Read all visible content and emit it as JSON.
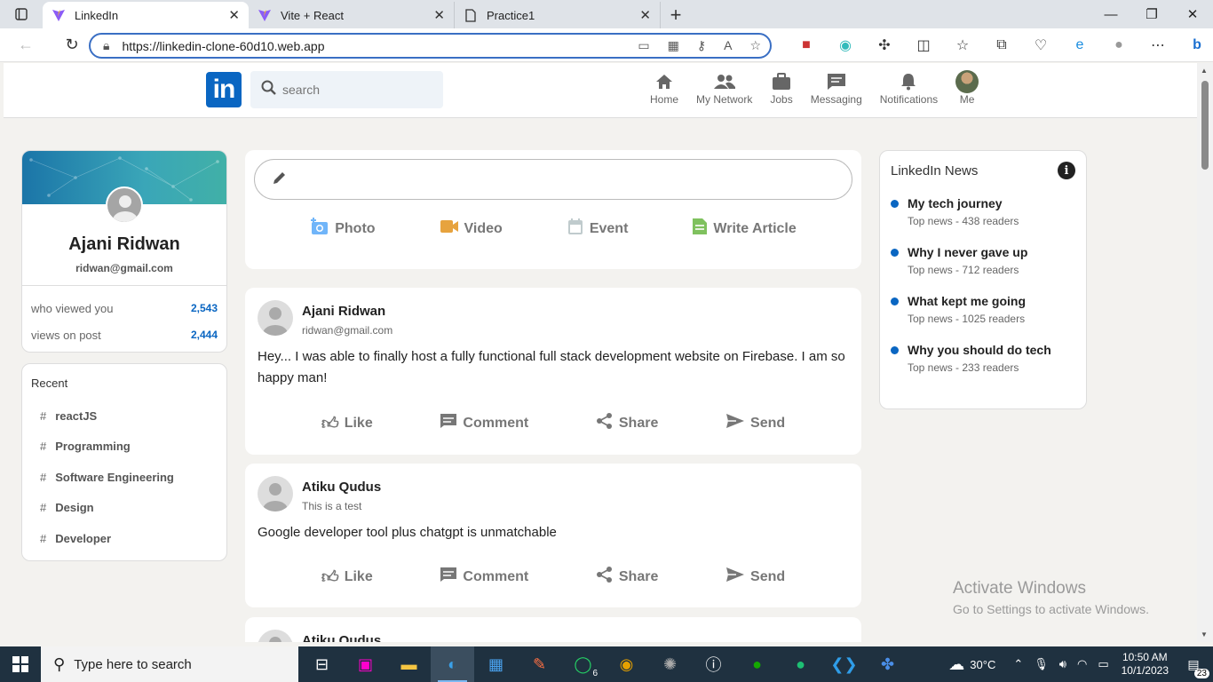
{
  "browser": {
    "tabs": [
      {
        "label": "LinkedIn",
        "active": true
      },
      {
        "label": "Vite + React",
        "active": false
      },
      {
        "label": "Practice1",
        "active": false
      }
    ],
    "url": "https://linkedin-clone-60d10.web.app"
  },
  "header": {
    "logo_text": "in",
    "search_placeholder": "search",
    "nav": [
      {
        "label": "Home",
        "icon": "home-icon"
      },
      {
        "label": "My Network",
        "icon": "network-icon"
      },
      {
        "label": "Jobs",
        "icon": "briefcase-icon"
      },
      {
        "label": "Messaging",
        "icon": "message-icon"
      },
      {
        "label": "Notifications",
        "icon": "bell-icon"
      },
      {
        "label": "Me",
        "icon": "avatar"
      }
    ]
  },
  "profile": {
    "name": "Ajani Ridwan",
    "email": "ridwan@gmail.com",
    "stats": [
      {
        "label": "who viewed you",
        "value": "2,543"
      },
      {
        "label": "views on post",
        "value": "2,444"
      }
    ]
  },
  "recent": {
    "title": "Recent",
    "items": [
      "reactJS",
      "Programming",
      "Software Engineering",
      "Design",
      "Developer"
    ]
  },
  "share": {
    "actions": [
      {
        "label": "Photo",
        "icon": "photo-icon",
        "color": "#70b5f9"
      },
      {
        "label": "Video",
        "icon": "video-icon",
        "color": "#e7a33e"
      },
      {
        "label": "Event",
        "icon": "calendar-icon",
        "color": "#c0cbcd"
      },
      {
        "label": "Write Article",
        "icon": "article-icon",
        "color": "#7fc15e"
      }
    ]
  },
  "posts": [
    {
      "name": "Ajani Ridwan",
      "desc": "ridwan@gmail.com",
      "message": "Hey... I was able to finally host a fully functional full stack development website on Firebase. I am so happy man!"
    },
    {
      "name": "Atiku Qudus",
      "desc": "This is a test",
      "message": "Google developer tool plus chatgpt is unmatchable"
    },
    {
      "name": "Atiku Qudus",
      "desc": "",
      "message": ""
    }
  ],
  "post_actions": [
    "Like",
    "Comment",
    "Share",
    "Send"
  ],
  "news": {
    "title": "LinkedIn News",
    "items": [
      {
        "heading": "My tech journey",
        "subtitle": "Top news - 438 readers"
      },
      {
        "heading": "Why I never gave up",
        "subtitle": "Top news - 712 readers"
      },
      {
        "heading": "What kept me going",
        "subtitle": "Top news - 1025 readers"
      },
      {
        "heading": "Why you should do tech",
        "subtitle": "Top news - 233 readers"
      }
    ]
  },
  "watermark": {
    "line1": "Activate Windows",
    "line2": "Go to Settings to activate Windows."
  },
  "taskbar": {
    "search_placeholder": "Type here to search",
    "weather": "30°C",
    "time": "10:50 AM",
    "date": "10/1/2023",
    "whatsapp_badge": "6",
    "notification_count": "23"
  },
  "colors": {
    "brand": "#0a66c2",
    "background": "#f3f2ef"
  }
}
